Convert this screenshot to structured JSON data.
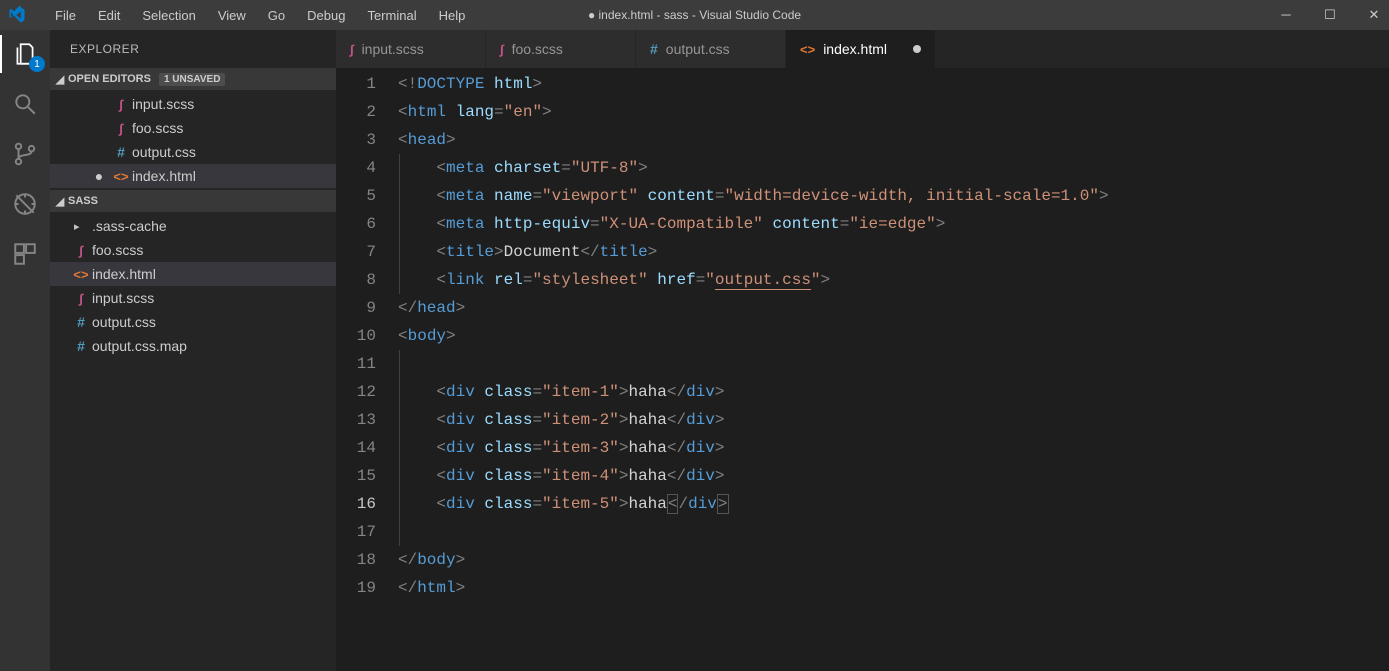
{
  "window_title": "● index.html - sass - Visual Studio Code",
  "menu": [
    "File",
    "Edit",
    "Selection",
    "View",
    "Go",
    "Debug",
    "Terminal",
    "Help"
  ],
  "activity_badge": "1",
  "explorer": {
    "title": "EXPLORER",
    "open_editors_label": "OPEN EDITORS",
    "unsaved_label": "1 UNSAVED",
    "open_editors": [
      {
        "name": "input.scss",
        "type": "scss",
        "modified": false
      },
      {
        "name": "foo.scss",
        "type": "scss",
        "modified": false
      },
      {
        "name": "output.css",
        "type": "css",
        "modified": false
      },
      {
        "name": "index.html",
        "type": "html",
        "modified": true
      }
    ],
    "workspace_label": "SASS",
    "files": [
      {
        "name": ".sass-cache",
        "type": "folder"
      },
      {
        "name": "foo.scss",
        "type": "scss"
      },
      {
        "name": "index.html",
        "type": "html",
        "active": true
      },
      {
        "name": "input.scss",
        "type": "scss"
      },
      {
        "name": "output.css",
        "type": "css"
      },
      {
        "name": "output.css.map",
        "type": "css"
      }
    ]
  },
  "tabs": [
    {
      "name": "input.scss",
      "type": "scss",
      "active": false
    },
    {
      "name": "foo.scss",
      "type": "scss",
      "active": false
    },
    {
      "name": "output.css",
      "type": "css",
      "active": false
    },
    {
      "name": "index.html",
      "type": "html",
      "active": true,
      "modified": true
    }
  ],
  "code": {
    "lines": [
      {
        "n": 1,
        "indent": 0,
        "tokens": [
          {
            "t": "<!",
            "c": "punct"
          },
          {
            "t": "DOCTYPE ",
            "c": "doctype"
          },
          {
            "t": "html",
            "c": "attr"
          },
          {
            "t": ">",
            "c": "punct"
          }
        ]
      },
      {
        "n": 2,
        "indent": 0,
        "tokens": [
          {
            "t": "<",
            "c": "punct"
          },
          {
            "t": "html ",
            "c": "tag"
          },
          {
            "t": "lang",
            "c": "attr"
          },
          {
            "t": "=",
            "c": "punct"
          },
          {
            "t": "\"en\"",
            "c": "str"
          },
          {
            "t": ">",
            "c": "punct"
          }
        ]
      },
      {
        "n": 3,
        "indent": 0,
        "tokens": [
          {
            "t": "<",
            "c": "punct"
          },
          {
            "t": "head",
            "c": "tag"
          },
          {
            "t": ">",
            "c": "punct"
          }
        ]
      },
      {
        "n": 4,
        "indent": 1,
        "tokens": [
          {
            "t": "    <",
            "c": "punct"
          },
          {
            "t": "meta ",
            "c": "tag"
          },
          {
            "t": "charset",
            "c": "attr"
          },
          {
            "t": "=",
            "c": "punct"
          },
          {
            "t": "\"UTF-8\"",
            "c": "str"
          },
          {
            "t": ">",
            "c": "punct"
          }
        ]
      },
      {
        "n": 5,
        "indent": 1,
        "tokens": [
          {
            "t": "    <",
            "c": "punct"
          },
          {
            "t": "meta ",
            "c": "tag"
          },
          {
            "t": "name",
            "c": "attr"
          },
          {
            "t": "=",
            "c": "punct"
          },
          {
            "t": "\"viewport\" ",
            "c": "str"
          },
          {
            "t": "content",
            "c": "attr"
          },
          {
            "t": "=",
            "c": "punct"
          },
          {
            "t": "\"width=device-width, initial-scale=1.0\"",
            "c": "str"
          },
          {
            "t": ">",
            "c": "punct"
          }
        ]
      },
      {
        "n": 6,
        "indent": 1,
        "tokens": [
          {
            "t": "    <",
            "c": "punct"
          },
          {
            "t": "meta ",
            "c": "tag"
          },
          {
            "t": "http-equiv",
            "c": "attr"
          },
          {
            "t": "=",
            "c": "punct"
          },
          {
            "t": "\"X-UA-Compatible\" ",
            "c": "str"
          },
          {
            "t": "content",
            "c": "attr"
          },
          {
            "t": "=",
            "c": "punct"
          },
          {
            "t": "\"ie=edge\"",
            "c": "str"
          },
          {
            "t": ">",
            "c": "punct"
          }
        ]
      },
      {
        "n": 7,
        "indent": 1,
        "tokens": [
          {
            "t": "    <",
            "c": "punct"
          },
          {
            "t": "title",
            "c": "tag"
          },
          {
            "t": ">",
            "c": "punct"
          },
          {
            "t": "Document",
            "c": "text"
          },
          {
            "t": "</",
            "c": "punct"
          },
          {
            "t": "title",
            "c": "tag"
          },
          {
            "t": ">",
            "c": "punct"
          }
        ]
      },
      {
        "n": 8,
        "indent": 1,
        "tokens": [
          {
            "t": "    <",
            "c": "punct"
          },
          {
            "t": "link ",
            "c": "tag"
          },
          {
            "t": "rel",
            "c": "attr"
          },
          {
            "t": "=",
            "c": "punct"
          },
          {
            "t": "\"stylesheet\" ",
            "c": "str"
          },
          {
            "t": "href",
            "c": "attr"
          },
          {
            "t": "=",
            "c": "punct"
          },
          {
            "t": "\"",
            "c": "str"
          },
          {
            "t": "output.css",
            "c": "str link-under"
          },
          {
            "t": "\"",
            "c": "str"
          },
          {
            "t": ">",
            "c": "punct"
          }
        ]
      },
      {
        "n": 9,
        "indent": 0,
        "tokens": [
          {
            "t": "</",
            "c": "punct"
          },
          {
            "t": "head",
            "c": "tag"
          },
          {
            "t": ">",
            "c": "punct"
          }
        ]
      },
      {
        "n": 10,
        "indent": 0,
        "tokens": [
          {
            "t": "<",
            "c": "punct"
          },
          {
            "t": "body",
            "c": "tag"
          },
          {
            "t": ">",
            "c": "punct"
          }
        ]
      },
      {
        "n": 11,
        "indent": 1,
        "tokens": []
      },
      {
        "n": 12,
        "indent": 1,
        "tokens": [
          {
            "t": "    <",
            "c": "punct"
          },
          {
            "t": "div ",
            "c": "tag"
          },
          {
            "t": "class",
            "c": "attr"
          },
          {
            "t": "=",
            "c": "punct"
          },
          {
            "t": "\"item-1\"",
            "c": "str"
          },
          {
            "t": ">",
            "c": "punct"
          },
          {
            "t": "haha",
            "c": "text"
          },
          {
            "t": "</",
            "c": "punct"
          },
          {
            "t": "div",
            "c": "tag"
          },
          {
            "t": ">",
            "c": "punct"
          }
        ]
      },
      {
        "n": 13,
        "indent": 1,
        "tokens": [
          {
            "t": "    <",
            "c": "punct"
          },
          {
            "t": "div ",
            "c": "tag"
          },
          {
            "t": "class",
            "c": "attr"
          },
          {
            "t": "=",
            "c": "punct"
          },
          {
            "t": "\"item-2\"",
            "c": "str"
          },
          {
            "t": ">",
            "c": "punct"
          },
          {
            "t": "haha",
            "c": "text"
          },
          {
            "t": "</",
            "c": "punct"
          },
          {
            "t": "div",
            "c": "tag"
          },
          {
            "t": ">",
            "c": "punct"
          }
        ]
      },
      {
        "n": 14,
        "indent": 1,
        "tokens": [
          {
            "t": "    <",
            "c": "punct"
          },
          {
            "t": "div ",
            "c": "tag"
          },
          {
            "t": "class",
            "c": "attr"
          },
          {
            "t": "=",
            "c": "punct"
          },
          {
            "t": "\"item-3\"",
            "c": "str"
          },
          {
            "t": ">",
            "c": "punct"
          },
          {
            "t": "haha",
            "c": "text"
          },
          {
            "t": "</",
            "c": "punct"
          },
          {
            "t": "div",
            "c": "tag"
          },
          {
            "t": ">",
            "c": "punct"
          }
        ]
      },
      {
        "n": 15,
        "indent": 1,
        "tokens": [
          {
            "t": "    <",
            "c": "punct"
          },
          {
            "t": "div ",
            "c": "tag"
          },
          {
            "t": "class",
            "c": "attr"
          },
          {
            "t": "=",
            "c": "punct"
          },
          {
            "t": "\"item-4\"",
            "c": "str"
          },
          {
            "t": ">",
            "c": "punct"
          },
          {
            "t": "haha",
            "c": "text"
          },
          {
            "t": "</",
            "c": "punct"
          },
          {
            "t": "div",
            "c": "tag"
          },
          {
            "t": ">",
            "c": "punct"
          }
        ]
      },
      {
        "n": 16,
        "indent": 1,
        "current": true,
        "tokens": [
          {
            "t": "    <",
            "c": "punct"
          },
          {
            "t": "div ",
            "c": "tag"
          },
          {
            "t": "class",
            "c": "attr"
          },
          {
            "t": "=",
            "c": "punct"
          },
          {
            "t": "\"item-5\"",
            "c": "str"
          },
          {
            "t": ">",
            "c": "punct"
          },
          {
            "t": "haha",
            "c": "text"
          },
          {
            "t": "<",
            "c": "punct bracket-box"
          },
          {
            "t": "/",
            "c": "punct"
          },
          {
            "t": "div",
            "c": "tag"
          },
          {
            "t": ">",
            "c": "punct bracket-box"
          }
        ]
      },
      {
        "n": 17,
        "indent": 1,
        "tokens": []
      },
      {
        "n": 18,
        "indent": 0,
        "tokens": [
          {
            "t": "</",
            "c": "punct"
          },
          {
            "t": "body",
            "c": "tag"
          },
          {
            "t": ">",
            "c": "punct"
          }
        ]
      },
      {
        "n": 19,
        "indent": 0,
        "tokens": [
          {
            "t": "</",
            "c": "punct"
          },
          {
            "t": "html",
            "c": "tag"
          },
          {
            "t": ">",
            "c": "punct"
          }
        ]
      }
    ]
  }
}
